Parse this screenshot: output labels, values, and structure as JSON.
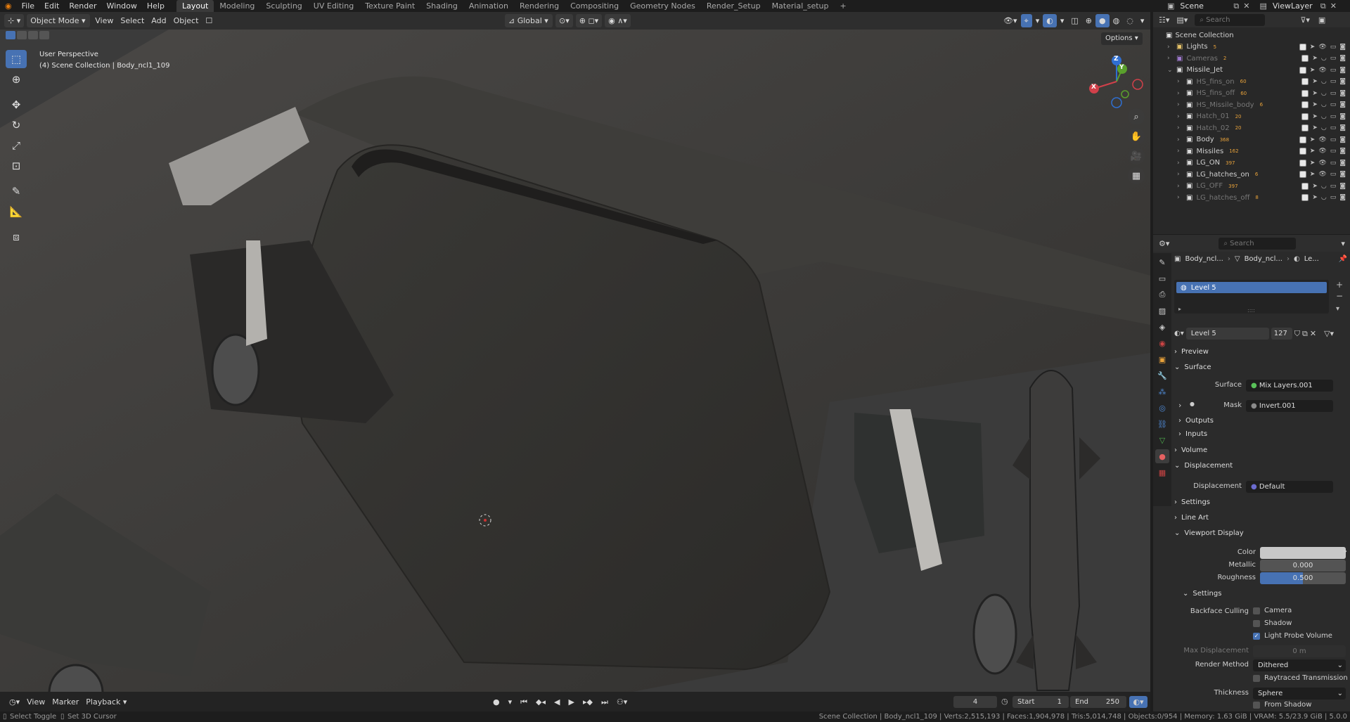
{
  "menu": {
    "file": "File",
    "edit": "Edit",
    "render": "Render",
    "window": "Window",
    "help": "Help"
  },
  "workspaces": [
    "Layout",
    "Modeling",
    "Sculpting",
    "UV Editing",
    "Texture Paint",
    "Shading",
    "Animation",
    "Rendering",
    "Compositing",
    "Geometry Nodes",
    "Render_Setup",
    "Material_setup"
  ],
  "active_workspace": "Layout",
  "scene": {
    "name": "Scene",
    "view_layer": "ViewLayer"
  },
  "viewport_header": {
    "mode": "Object Mode",
    "view": "View",
    "select": "Select",
    "add": "Add",
    "object": "Object",
    "orientation": "Global",
    "options": "Options"
  },
  "viewport": {
    "perspective": "User Perspective",
    "collection_info": "(4) Scene Collection | Body_ncl1_109",
    "gizmo_x": "X",
    "gizmo_y": "Y",
    "gizmo_z": "Z"
  },
  "outliner": {
    "search_placeholder": "Search",
    "root": "Scene Collection",
    "rows": [
      {
        "name": "Lights",
        "badge": "5",
        "indent": 1,
        "dim": false
      },
      {
        "name": "Cameras",
        "badge": "2",
        "indent": 1,
        "dim": true
      },
      {
        "name": "Missile_Jet",
        "badge": "",
        "indent": 1,
        "dim": false
      },
      {
        "name": "HS_fins_on",
        "badge": "60",
        "indent": 2,
        "dim": true
      },
      {
        "name": "HS_fins_off",
        "badge": "60",
        "indent": 2,
        "dim": true
      },
      {
        "name": "HS_Missile_body",
        "badge": "6",
        "indent": 2,
        "dim": true
      },
      {
        "name": "Hatch_01",
        "badge": "20",
        "indent": 2,
        "dim": true
      },
      {
        "name": "Hatch_02",
        "badge": "20",
        "indent": 2,
        "dim": true
      },
      {
        "name": "Body",
        "badge": "368",
        "indent": 2,
        "dim": false
      },
      {
        "name": "Missiles",
        "badge": "162",
        "indent": 2,
        "dim": false
      },
      {
        "name": "LG_ON",
        "badge": "397",
        "indent": 2,
        "dim": false
      },
      {
        "name": "LG_hatches_on",
        "badge": "6",
        "indent": 2,
        "dim": false
      },
      {
        "name": "LG_OFF",
        "badge": "397",
        "indent": 2,
        "dim": true
      },
      {
        "name": "LG_hatches_off",
        "badge": "8",
        "indent": 2,
        "dim": true
      }
    ]
  },
  "properties": {
    "search_placeholder": "Search",
    "breadcrumb": [
      "Body_ncl...",
      "Body_ncl...",
      "Le..."
    ],
    "material_slot": "Level 5",
    "material_name": "Level 5",
    "material_users": "127",
    "sections": {
      "preview": "Preview",
      "surface": "Surface",
      "outputs": "Outputs",
      "inputs": "Inputs",
      "volume": "Volume",
      "displacement": "Displacement",
      "settings": "Settings",
      "line_art": "Line Art",
      "viewport_display": "Viewport Display",
      "settings_sub": "Settings"
    },
    "surface_label": "Surface",
    "surface_value": "Mix Layers.001",
    "mask_label": "Mask",
    "mask_value": "Invert.001",
    "displacement_label": "Displacement",
    "displacement_value": "Default",
    "color_label": "Color",
    "color_hex": "#c8c8c8",
    "metallic_label": "Metallic",
    "metallic_value": "0.000",
    "roughness_label": "Roughness",
    "roughness_value": "0.500",
    "roughness_fraction": 0.5,
    "backface_culling_label": "Backface Culling",
    "camera_label": "Camera",
    "camera_checked": false,
    "shadow_label": "Shadow",
    "shadow_checked": false,
    "light_probe_label": "Light Probe Volume",
    "light_probe_checked": true,
    "max_disp_label": "Max Displacement",
    "max_disp_value": "0 m",
    "render_method_label": "Render Method",
    "render_method_value": "Dithered",
    "raytraced_label": "Raytraced Transmission",
    "raytraced_checked": false,
    "thickness_label": "Thickness",
    "thickness_value": "Sphere",
    "from_shadow_label": "From Shadow",
    "from_shadow_checked": false
  },
  "timeline": {
    "view": "View",
    "marker": "Marker",
    "playback": "Playback",
    "current_frame": "4",
    "start_label": "Start",
    "start": "1",
    "end_label": "End",
    "end": "250"
  },
  "status": {
    "left1": "Select Toggle",
    "left2": "Set 3D Cursor",
    "right": "Scene Collection | Body_ncl1_109 | Verts:2,515,193 | Faces:1,904,978 | Tris:5,014,748 | Objects:0/954 | Memory: 1.63 GiB | VRAM: 5.5/23.9 GiB | 5.0.0"
  },
  "colors": {
    "accent": "#4772b3",
    "bg": "#1d1d1d",
    "panel": "#2b2b2b"
  }
}
